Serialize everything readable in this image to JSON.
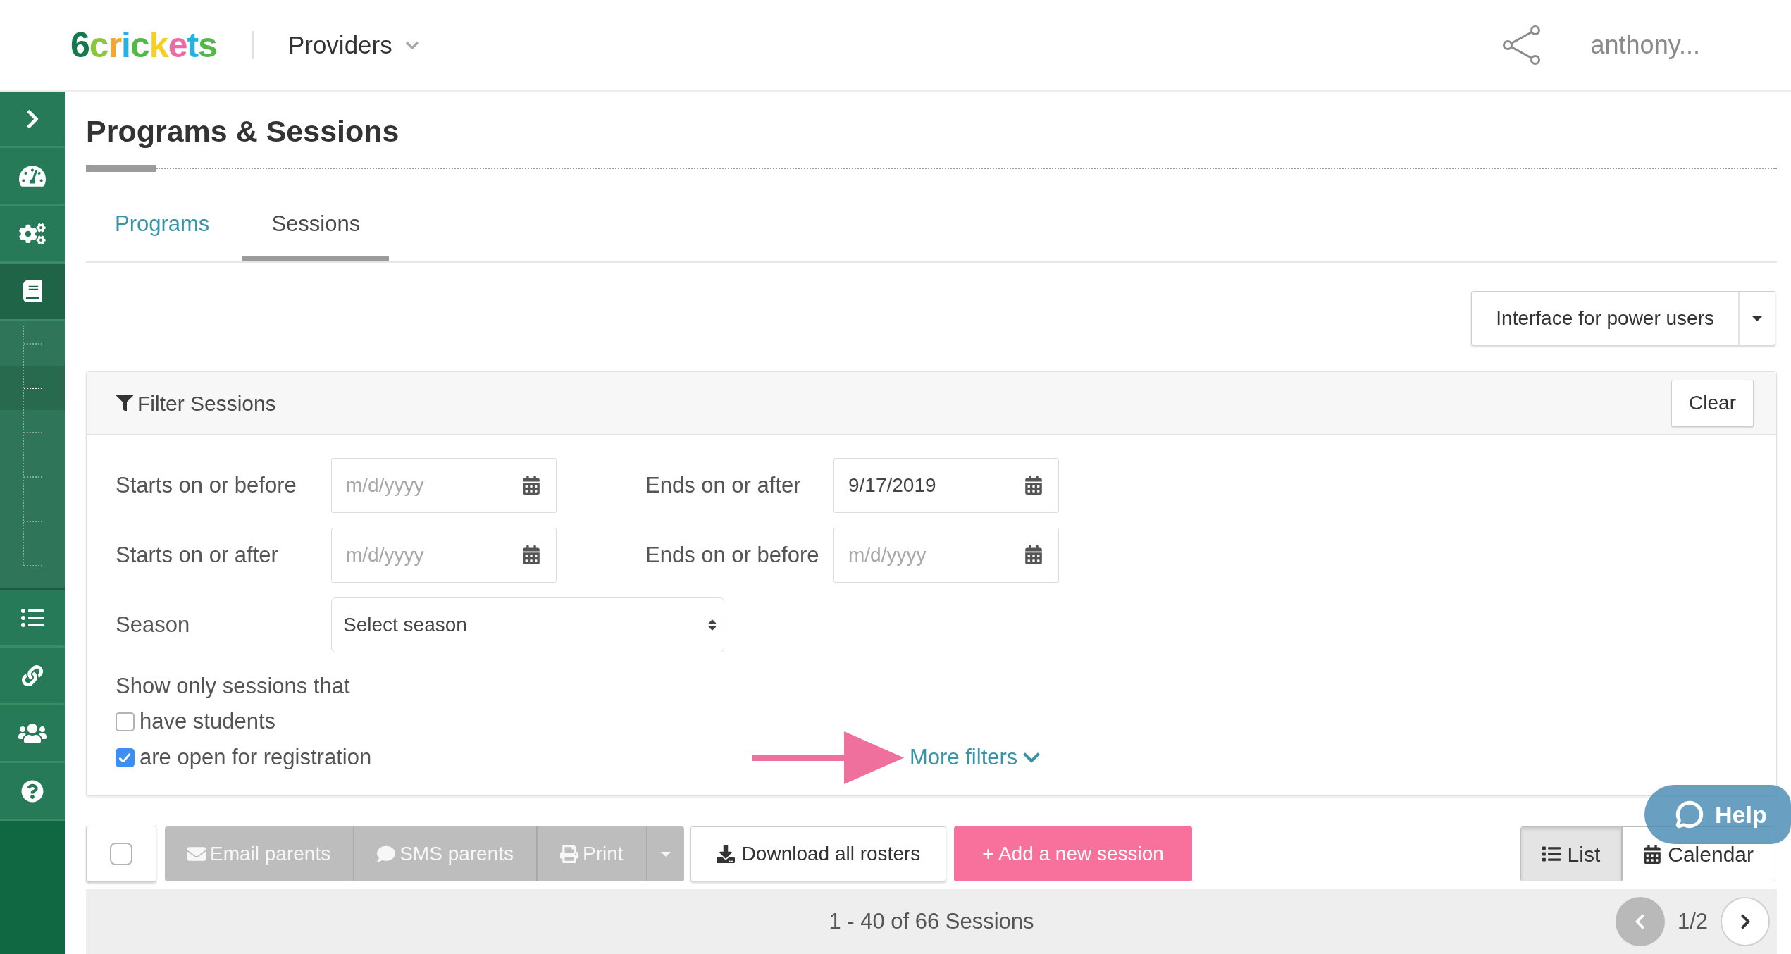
{
  "header": {
    "logo": "6crickets",
    "menu": {
      "label": "Providers"
    },
    "user": {
      "label": "anthony..."
    }
  },
  "sidebar": {
    "items": [
      {
        "selected": false
      },
      {
        "selected": false
      },
      {
        "selected": true,
        "children": [
          {
            "selected": false
          },
          {
            "selected": true
          },
          {
            "selected": false
          },
          {
            "selected": false
          },
          {
            "selected": false
          },
          {
            "selected": false
          }
        ]
      },
      {
        "selected": false
      },
      {
        "selected": false
      },
      {
        "selected": false
      },
      {
        "selected": false
      }
    ]
  },
  "page": {
    "title": "Programs & Sessions"
  },
  "tabs": [
    {
      "label": "Programs",
      "selected": false
    },
    {
      "label": "Sessions",
      "selected": true
    }
  ],
  "interface_menu": {
    "label": "Interface for power users"
  },
  "filter": {
    "title": "Filter Sessions",
    "clear": "Clear",
    "date_fields": [
      {
        "label": "Starts on or before",
        "placeholder": "m/d/yyyy"
      },
      {
        "label": "Ends on or after",
        "value": "9/17/2019"
      },
      {
        "label": "Starts on or after",
        "placeholder": "m/d/yyyy"
      },
      {
        "label": "Ends on or before",
        "placeholder": "m/d/yyyy"
      }
    ],
    "season": {
      "label": "Season",
      "value": "Select season"
    },
    "show_only": {
      "label": "Show only sessions that",
      "options": [
        {
          "label": "have students",
          "checked": false
        },
        {
          "label": "are open for registration",
          "checked": true
        }
      ]
    },
    "more_filters": "More filters"
  },
  "toolbar": {
    "select_all": {
      "checked": false
    },
    "actions": [
      {
        "label": "Email parents",
        "disabled": true
      },
      {
        "label": "SMS parents",
        "disabled": true
      },
      {
        "label": "Print",
        "disabled": true
      }
    ],
    "more_actions": {
      "disabled": true
    },
    "download": "Download all rosters",
    "add": "+ Add a new session",
    "views": [
      {
        "label": "List",
        "selected": true
      },
      {
        "label": "Calendar",
        "selected": false
      }
    ]
  },
  "pager": {
    "summary": "1 - 40 of 66 Sessions",
    "page": "1/2",
    "prev": {
      "disabled": true
    },
    "next": {
      "disabled": false
    }
  },
  "help": {
    "label": "Help"
  }
}
